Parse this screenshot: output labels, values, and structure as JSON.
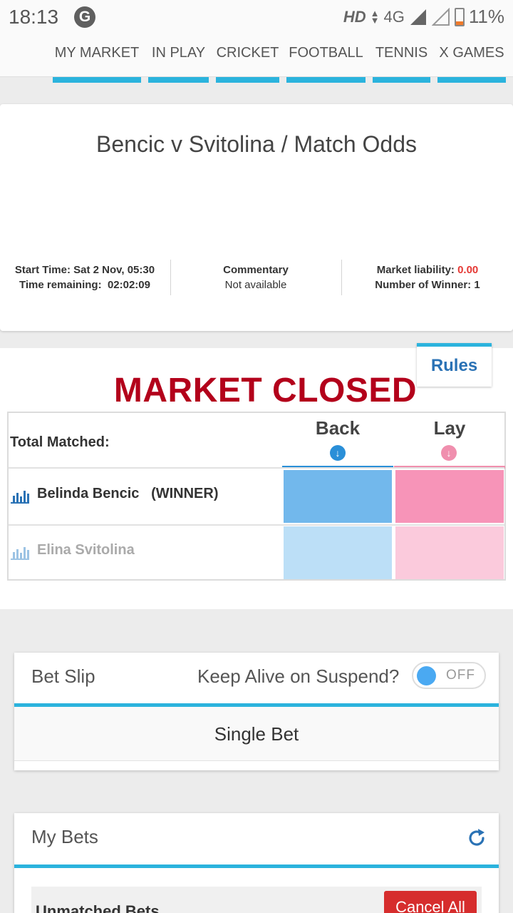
{
  "status_bar": {
    "time": "18:13",
    "g_icon": "G",
    "hd": "HD",
    "network": "4G",
    "battery": "11%"
  },
  "nav": {
    "tabs": [
      "MY MARKET",
      "IN PLAY",
      "CRICKET",
      "FOOTBALL",
      "TENNIS",
      "X GAMES"
    ]
  },
  "market": {
    "title": "Bencic v Svitolina / Match Odds",
    "start_time_label": "Start Time:",
    "start_time": "Sat 2 Nov, 05:30",
    "time_remaining_label": "Time remaining:",
    "time_remaining": "02:02:09",
    "commentary_label": "Commentary",
    "commentary_value": "Not available",
    "liability_label": "Market liability:",
    "liability_value": "0.00",
    "winners_label": "Number of Winner:",
    "winners_value": "1"
  },
  "odds": {
    "rules_label": "Rules",
    "status_banner": "MARKET CLOSED",
    "total_matched_label": "Total Matched:",
    "back_label": "Back",
    "lay_label": "Lay",
    "runners": [
      {
        "name": "Belinda Bencic",
        "tag": "(WINNER)"
      },
      {
        "name": "Elina Svitolina",
        "tag": ""
      }
    ],
    "colors": {
      "back": "#72b8ec",
      "lay": "#f794b8",
      "back_faded": "#bcdff7",
      "lay_faded": "#fbcadc",
      "closed": "#b3001b"
    }
  },
  "bet_slip": {
    "title": "Bet Slip",
    "keep_alive_label": "Keep Alive on Suspend?",
    "toggle_state": "OFF",
    "single_bet_label": "Single Bet"
  },
  "my_bets": {
    "title": "My Bets",
    "unmatched_label": "Unmatched Bets",
    "cancel_all_label": "Cancel All"
  }
}
